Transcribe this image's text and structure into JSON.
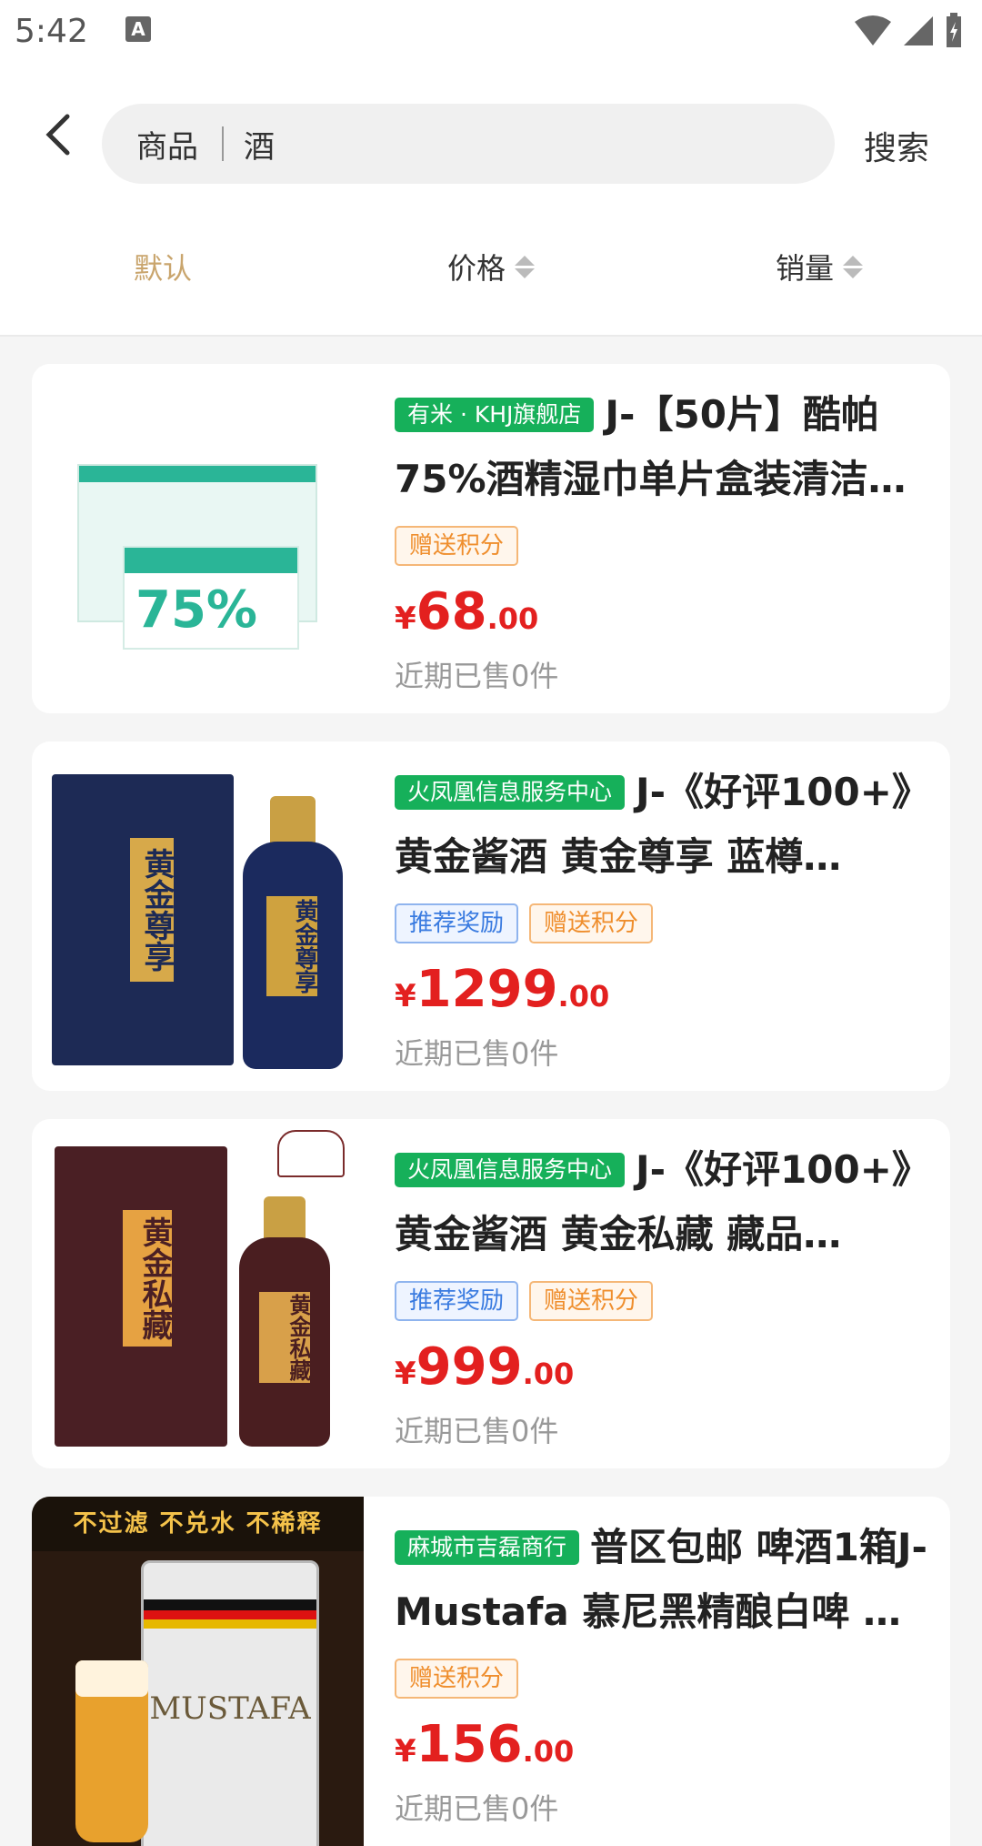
{
  "status_bar": {
    "time": "5:42",
    "a_icon": "A"
  },
  "header": {
    "search_category": "商品",
    "search_query": "酒",
    "search_button": "搜索"
  },
  "sort_bar": {
    "default": "默认",
    "price": "价格",
    "sales": "销量",
    "active": "default"
  },
  "products": [
    {
      "shop": "有米 · KHJ旗舰店",
      "title": "J-【50片】酷帕75%酒精湿巾单片盒装清洁…",
      "tags": [
        "赠送积分"
      ],
      "price_symbol": "¥",
      "price_int": "68",
      "price_dec": ".00",
      "sold": "近期已售0件",
      "image_text": "75%"
    },
    {
      "shop": "火凤凰信息服务中心",
      "title": "J-《好评100+》黄金酱酒 黄金尊享 蓝樽…",
      "tags": [
        "推荐奖励",
        "赠送积分"
      ],
      "price_symbol": "¥",
      "price_int": "1299",
      "price_dec": ".00",
      "sold": "近期已售0件",
      "image_text": "黄金尊享"
    },
    {
      "shop": "火凤凰信息服务中心",
      "title": "J-《好评100+》黄金酱酒 黄金私藏 藏品…",
      "tags": [
        "推荐奖励",
        "赠送积分"
      ],
      "price_symbol": "¥",
      "price_int": "999",
      "price_dec": ".00",
      "sold": "近期已售0件",
      "image_text": "黄金私藏"
    },
    {
      "shop": "麻城市吉磊商行",
      "title": "普区包邮 啤酒1箱J-Mustafa 慕尼黑精酿白啤 …",
      "tags": [
        "赠送积分"
      ],
      "price_symbol": "¥",
      "price_int": "156",
      "price_dec": ".00",
      "sold": "近期已售0件",
      "image_banner": "不过滤 不兑水 不稀释",
      "image_text": "MUSTAFA"
    }
  ],
  "colors": {
    "accent_gold": "#c9a56d",
    "price_red": "#e3201f",
    "shop_green": "#16b05a",
    "reward_blue": "#3a7be0",
    "points_orange": "#ef8e2d"
  }
}
